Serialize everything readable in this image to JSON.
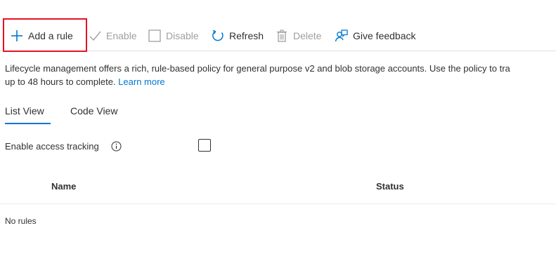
{
  "toolbar": {
    "add_rule": "Add a rule",
    "enable": "Enable",
    "disable": "Disable",
    "refresh": "Refresh",
    "delete": "Delete",
    "give_feedback": "Give feedback"
  },
  "icons": {
    "add": "plus-icon",
    "enable": "checkmark-icon",
    "disable": "checkbox-outline-icon",
    "refresh": "refresh-icon",
    "delete": "trash-icon",
    "feedback": "feedback-person-icon",
    "info": "info-icon"
  },
  "description": {
    "line1": "Lifecycle management offers a rich, rule-based policy for general purpose v2 and blob storage accounts. Use the policy to tra",
    "line2": "up to 48 hours to complete.",
    "learn_more": "Learn more"
  },
  "tabs": [
    {
      "label": "List View",
      "selected": true
    },
    {
      "label": "Code View",
      "selected": false
    }
  ],
  "access_tracking": {
    "label": "Enable access tracking",
    "checked": false
  },
  "table": {
    "columns": [
      "Name",
      "Status"
    ],
    "empty_message": "No rules"
  },
  "colors": {
    "accent": "#0078d4",
    "highlight": "#e81123",
    "disabled_text": "#a19f9d",
    "text": "#323130"
  }
}
